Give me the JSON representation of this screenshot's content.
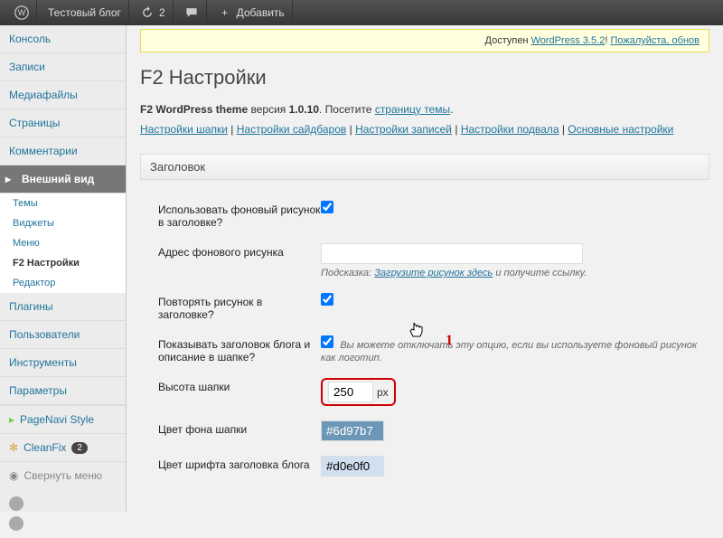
{
  "toolbar": {
    "site_title": "Тестовый блог",
    "updates_count": "2",
    "add_label": "Добавить"
  },
  "sidebar": {
    "items": [
      "Консоль",
      "Записи",
      "Медиафайлы",
      "Страницы",
      "Комментарии",
      "Внешний вид",
      "Плагины",
      "Пользователи",
      "Инструменты",
      "Параметры"
    ],
    "submenu": [
      "Темы",
      "Виджеты",
      "Меню",
      "F2 Настройки",
      "Редактор"
    ],
    "pagenavi": "PageNavi Style",
    "cleanfix": "CleanFix",
    "cleanfix_badge": "2",
    "collapse": "Свернуть меню"
  },
  "notice": {
    "prefix": "Доступен ",
    "link1": "WordPress 3.5.2",
    "mid": "! ",
    "link2": "Пожалуйста, обнов"
  },
  "page_title": "F2 Настройки",
  "theme_info": {
    "name": "F2 WordPress theme",
    "version_label": " версия ",
    "version": "1.0.10",
    "visit_label": ". Посетите ",
    "visit_link": "страницу темы",
    "dot": "."
  },
  "tabs": [
    "Настройки шапки",
    "Настройки сайдбаров",
    "Настройки записей",
    "Настройки подвала",
    "Основные настройки"
  ],
  "section": "Заголовок",
  "rows": {
    "use_bg": {
      "label": "Использовать фоновый рисунок в заголовке?"
    },
    "bg_url": {
      "label": "Адрес фонового рисунка",
      "value": "",
      "hint_prefix": "Подсказка: ",
      "hint_link": "Загрузите рисунок здесь",
      "hint_suffix": " и получите ссылку."
    },
    "repeat": {
      "label": "Повторять рисунок в заголовке?"
    },
    "show_title": {
      "label": "Показывать заголовок блога и описание в шапке?",
      "desc": "Вы можете отключать эту опцию, если вы используете фоновый рисунок как логотип."
    },
    "height": {
      "label": "Высота шапки",
      "value": "250",
      "unit": "px"
    },
    "bg_color": {
      "label": "Цвет фона шапки",
      "value": "#6d97b7"
    },
    "title_color": {
      "label": "Цвет шрифта заголовка блога",
      "value": "#d0e0f0"
    }
  },
  "marker": "1"
}
